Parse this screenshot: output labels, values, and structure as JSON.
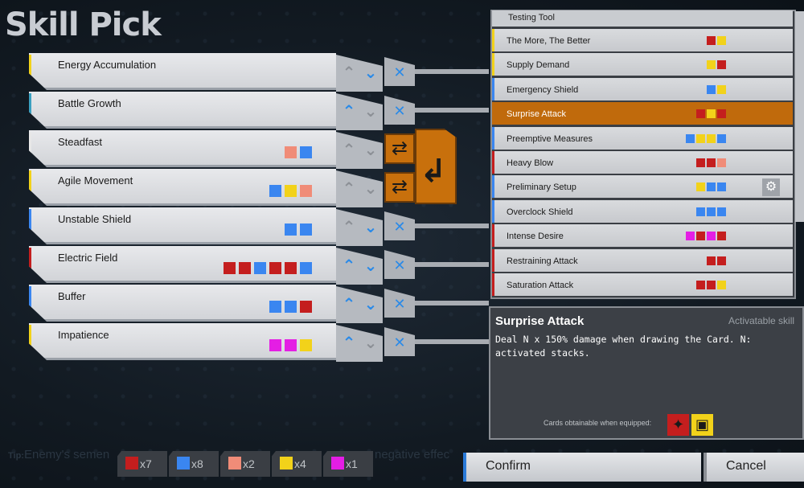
{
  "title": "Skill Pick",
  "colors": {
    "red": "#c41e1e",
    "yellow": "#f2d21a",
    "blue": "#3a86f0",
    "salmon": "#f08c78",
    "magenta": "#e41ee4",
    "orange": "#c06a0c"
  },
  "slots": [
    {
      "name": "Energy Accumulation",
      "squares": [],
      "accent": "#f2d21a",
      "up": "off",
      "down": "on",
      "action": "x"
    },
    {
      "name": "Battle Growth",
      "squares": [],
      "accent": "#3aa0c0",
      "up": "on",
      "down": "off",
      "action": "x"
    },
    {
      "name": "Steadfast",
      "squares": [
        "salmon",
        "blue"
      ],
      "accent": "#e8e8e8",
      "up": "off",
      "down": "off",
      "action": "swap"
    },
    {
      "name": "Agile Movement",
      "squares": [
        "blue",
        "yellow",
        "salmon"
      ],
      "accent": "#f2d21a",
      "up": "off",
      "down": "off",
      "action": "swap"
    },
    {
      "name": "Unstable Shield",
      "squares": [
        "blue",
        "blue"
      ],
      "accent": "#3a86f0",
      "up": "off",
      "down": "on",
      "action": "x"
    },
    {
      "name": "Electric Field",
      "squares": [
        "red",
        "red",
        "blue",
        "red",
        "red",
        "blue"
      ],
      "accent": "#c41e1e",
      "up": "on",
      "down": "on",
      "action": "x"
    },
    {
      "name": "Buffer",
      "squares": [
        "blue",
        "blue",
        "red"
      ],
      "accent": "#3a86f0",
      "up": "on",
      "down": "on",
      "action": "x"
    },
    {
      "name": "Impatience",
      "squares": [
        "magenta",
        "magenta",
        "yellow"
      ],
      "accent": "#f2d21a",
      "up": "on",
      "down": "off",
      "action": "x"
    }
  ],
  "list_header": "Testing Tool",
  "skill_list": [
    {
      "name": "The More, The Better",
      "squares": [
        "red",
        "yellow"
      ],
      "accent": "#f2d21a"
    },
    {
      "name": "Supply Demand",
      "squares": [
        "yellow",
        "red"
      ],
      "accent": "#f2d21a"
    },
    {
      "name": "Emergency Shield",
      "squares": [
        "blue",
        "yellow"
      ],
      "accent": "#3a86f0"
    },
    {
      "name": "Surprise Attack",
      "squares": [
        "red",
        "yellow",
        "red"
      ],
      "accent": "#c06a0c",
      "active": true
    },
    {
      "name": "Preemptive Measures",
      "squares": [
        "blue",
        "yellow",
        "yellow",
        "blue"
      ],
      "accent": "#3a86f0"
    },
    {
      "name": "Heavy Blow",
      "squares": [
        "red",
        "red",
        "salmon"
      ],
      "accent": "#c41e1e"
    },
    {
      "name": "Preliminary Setup",
      "squares": [
        "yellow",
        "blue",
        "blue"
      ],
      "accent": "#3a86f0",
      "gear": true
    },
    {
      "name": "Overclock Shield",
      "squares": [
        "blue",
        "blue",
        "blue"
      ],
      "accent": "#3a86f0"
    },
    {
      "name": "Intense Desire",
      "squares": [
        "magenta",
        "red",
        "magenta",
        "red"
      ],
      "accent": "#c41e1e"
    },
    {
      "name": "Restraining Attack",
      "squares": [
        "red",
        "red"
      ],
      "accent": "#c41e1e"
    },
    {
      "name": "Saturation Attack",
      "squares": [
        "red",
        "red",
        "yellow"
      ],
      "accent": "#c41e1e"
    }
  ],
  "detail": {
    "title": "Surprise Attack",
    "tag": "Activatable skill",
    "description": "Deal N x 150% damage when drawing the Card. N: activated stacks.",
    "cards_label": "Cards obtainable when equipped:"
  },
  "tip": {
    "label": "Tip:",
    "text": "Enemy's semen",
    "tail": "negative effec"
  },
  "counters": [
    {
      "color": "red",
      "text": "x7"
    },
    {
      "color": "blue",
      "text": "x8"
    },
    {
      "color": "salmon",
      "text": "x2"
    },
    {
      "color": "yellow",
      "text": "x4"
    },
    {
      "color": "magenta",
      "text": "x1"
    }
  ],
  "buttons": {
    "confirm": "Confirm",
    "cancel": "Cancel"
  }
}
